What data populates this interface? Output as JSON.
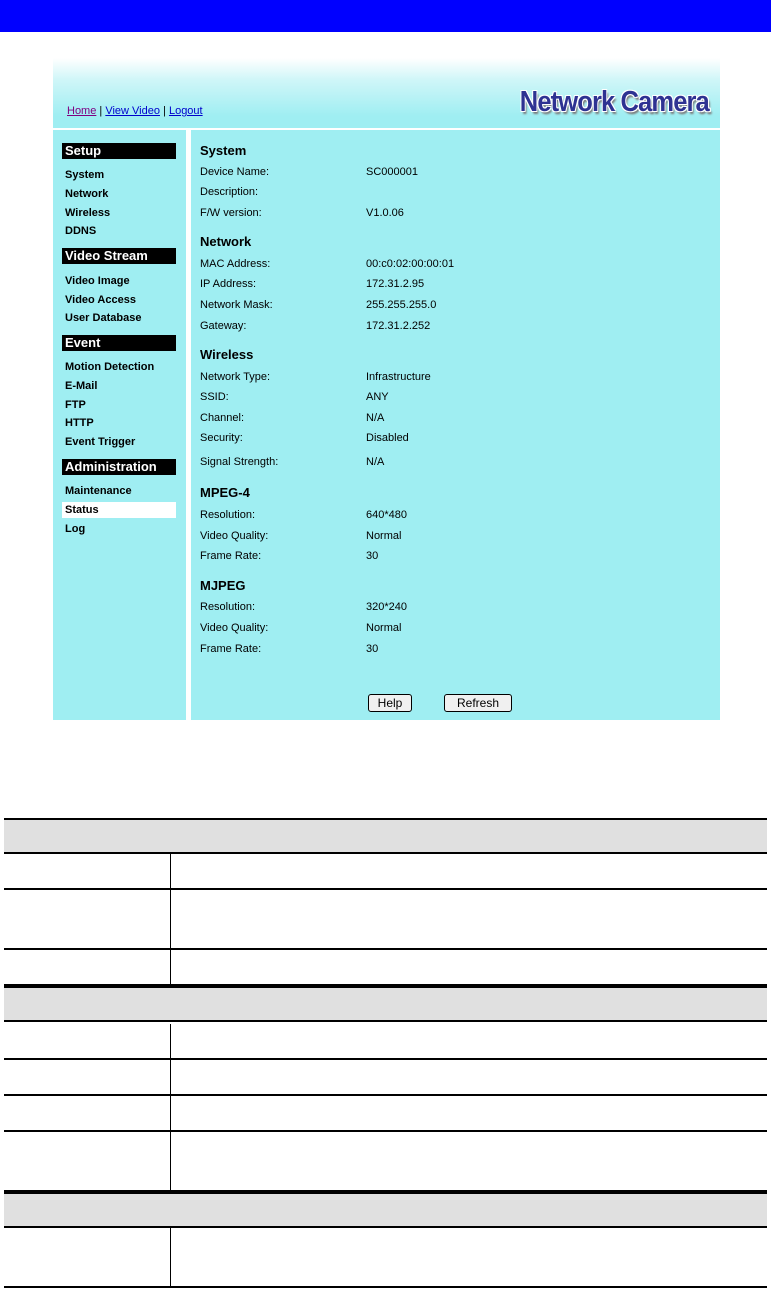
{
  "nav": {
    "home": "Home",
    "separator": "|",
    "view_video": "View Video",
    "logout": "Logout"
  },
  "brand": "Network Camera",
  "sidebar": {
    "sections": [
      {
        "title": "Setup",
        "items": [
          "System",
          "Network",
          "Wireless",
          "DDNS"
        ]
      },
      {
        "title": "Video Stream",
        "items": [
          "Video Image",
          "Video Access",
          "User Database"
        ]
      },
      {
        "title": "Event",
        "items": [
          "Motion Detection",
          "E-Mail",
          "FTP",
          "HTTP",
          "Event Trigger"
        ]
      },
      {
        "title": "Administration",
        "items": [
          "Maintenance",
          "Status",
          "Log"
        ]
      }
    ],
    "selected": "Status"
  },
  "status": {
    "system": {
      "title": "System",
      "rows": [
        {
          "label": "Device Name:",
          "value": "SC000001"
        },
        {
          "label": "Description:",
          "value": ""
        },
        {
          "label": "F/W version:",
          "value": "V1.0.06"
        }
      ]
    },
    "network": {
      "title": "Network",
      "rows": [
        {
          "label": "MAC Address:",
          "value": "00:c0:02:00:00:01"
        },
        {
          "label": "IP Address:",
          "value": "172.31.2.95"
        },
        {
          "label": "Network Mask:",
          "value": "255.255.255.0"
        },
        {
          "label": "Gateway:",
          "value": "172.31.2.252"
        }
      ]
    },
    "wireless": {
      "title": "Wireless",
      "rows": [
        {
          "label": "Network Type:",
          "value": "Infrastructure"
        },
        {
          "label": "SSID:",
          "value": "ANY"
        },
        {
          "label": "Channel:",
          "value": "N/A"
        },
        {
          "label": "Security:",
          "value": "Disabled"
        },
        {
          "label": "Signal Strength:",
          "value": "N/A"
        }
      ]
    },
    "mpeg4": {
      "title": "MPEG-4",
      "rows": [
        {
          "label": "Resolution:",
          "value": "640*480"
        },
        {
          "label": "Video Quality:",
          "value": "Normal"
        },
        {
          "label": "Frame Rate:",
          "value": "30"
        }
      ]
    },
    "mjpeg": {
      "title": "MJPEG",
      "rows": [
        {
          "label": "Resolution:",
          "value": "320*240"
        },
        {
          "label": "Video Quality:",
          "value": "Normal"
        },
        {
          "label": "Frame Rate:",
          "value": "30"
        }
      ]
    }
  },
  "buttons": {
    "help": "Help",
    "refresh": "Refresh"
  },
  "colors": {
    "top_bar": "#0000ff",
    "panel_bg": "#9feef2",
    "section_header_bg": "#000000",
    "brand_text": "#2e3292",
    "link": "#0000cc",
    "table_group_bg": "#e0e0e0"
  }
}
